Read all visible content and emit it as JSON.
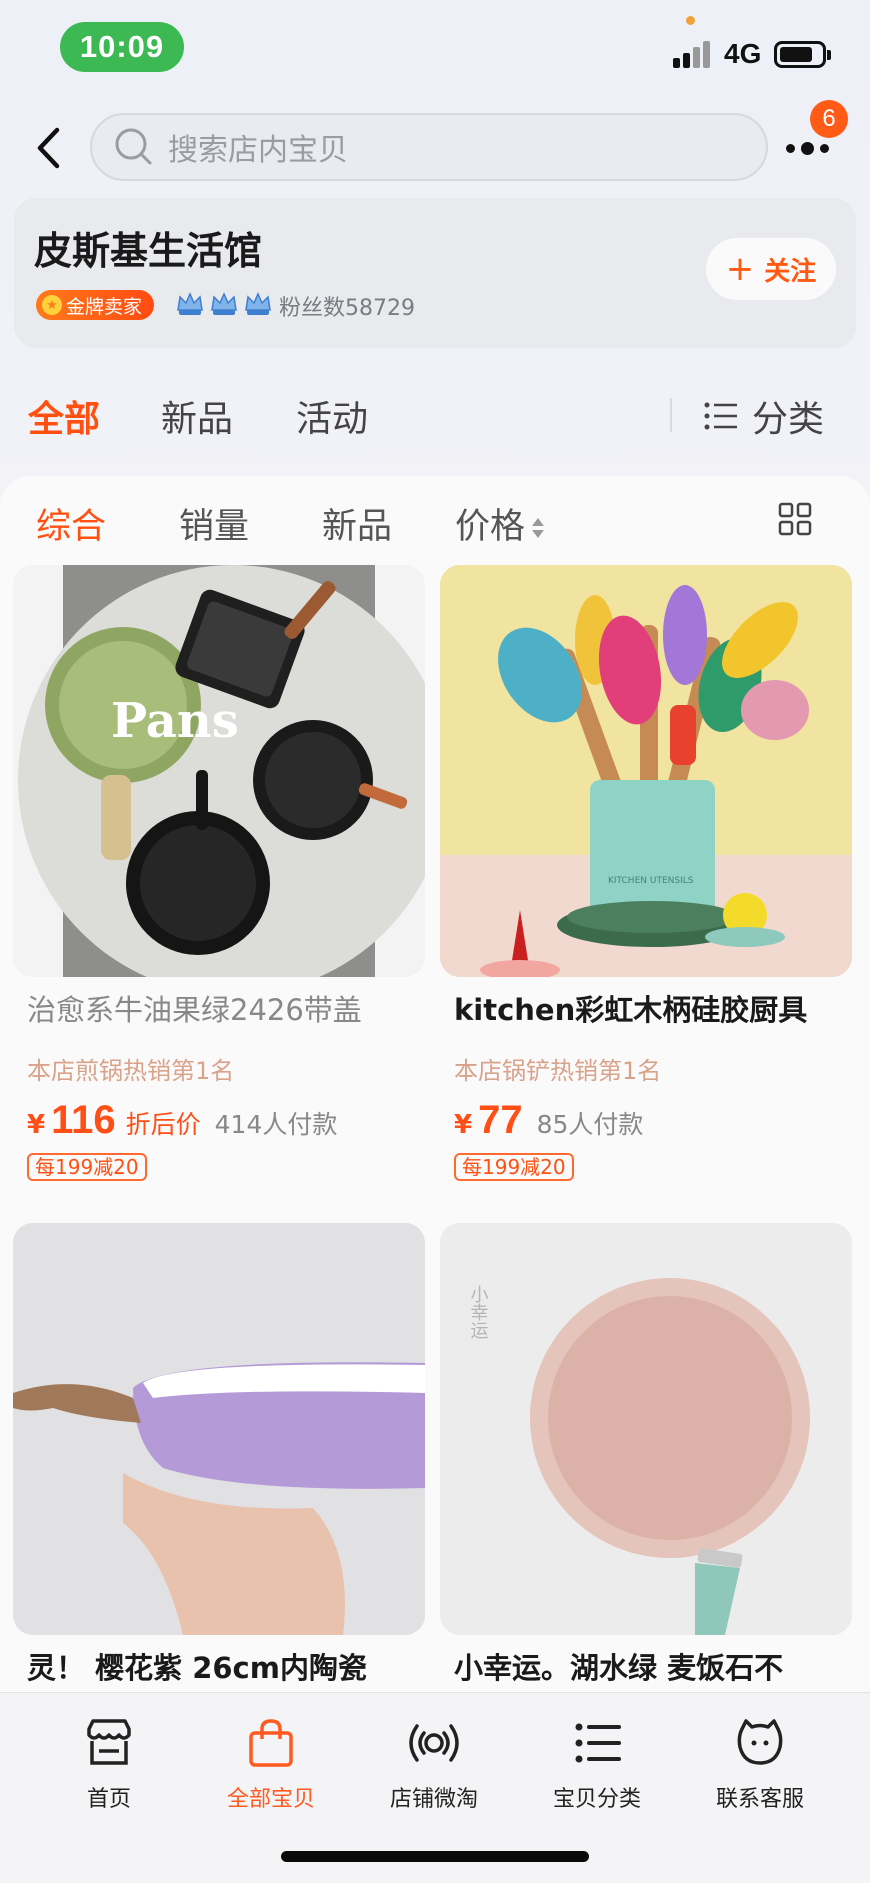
{
  "status_bar": {
    "time": "10:09",
    "network": "4G"
  },
  "search": {
    "placeholder": "搜索店内宝贝",
    "notification_count": "6"
  },
  "store": {
    "name": "皮斯基生活馆",
    "badge": "金牌卖家",
    "fans_label": "粉丝数58729",
    "follow_label": "关注"
  },
  "tabs": {
    "all": "全部",
    "new": "新品",
    "activity": "活动",
    "category": "分类"
  },
  "sort": {
    "overall": "综合",
    "sales": "销量",
    "new": "新品",
    "price": "价格"
  },
  "products": [
    {
      "title": "治愈系牛油果绿2426带盖",
      "rank": "本店煎锅热销第1名",
      "yen": "¥",
      "price": "116",
      "discount_label": "折后价",
      "sold": "414人付款",
      "coupon": "每199减20",
      "image_text": "Pans"
    },
    {
      "title": "kitchen彩虹木柄硅胶厨具",
      "rank": "本店锅铲热销第1名",
      "yen": "¥",
      "price": "77",
      "discount_label": "",
      "sold": "85人付款",
      "coupon": "每199减20",
      "image_text": "KITCHEN UTENSILS"
    },
    {
      "title": "灵！ 樱花紫 26cm内陶瓷"
    },
    {
      "title": "小幸运。湖水绿 麦饭石不",
      "image_text": "小幸运"
    }
  ],
  "bottom_nav": [
    {
      "label": "首页",
      "icon": "store-icon"
    },
    {
      "label": "全部宝贝",
      "icon": "shopping-bag-icon"
    },
    {
      "label": "店铺微淘",
      "icon": "broadcast-icon"
    },
    {
      "label": "宝贝分类",
      "icon": "list-icon"
    },
    {
      "label": "联系客服",
      "icon": "customer-service-icon"
    }
  ],
  "colors": {
    "accent": "#ff5012",
    "status_green": "#3db953",
    "badge": "#ff5b16"
  }
}
